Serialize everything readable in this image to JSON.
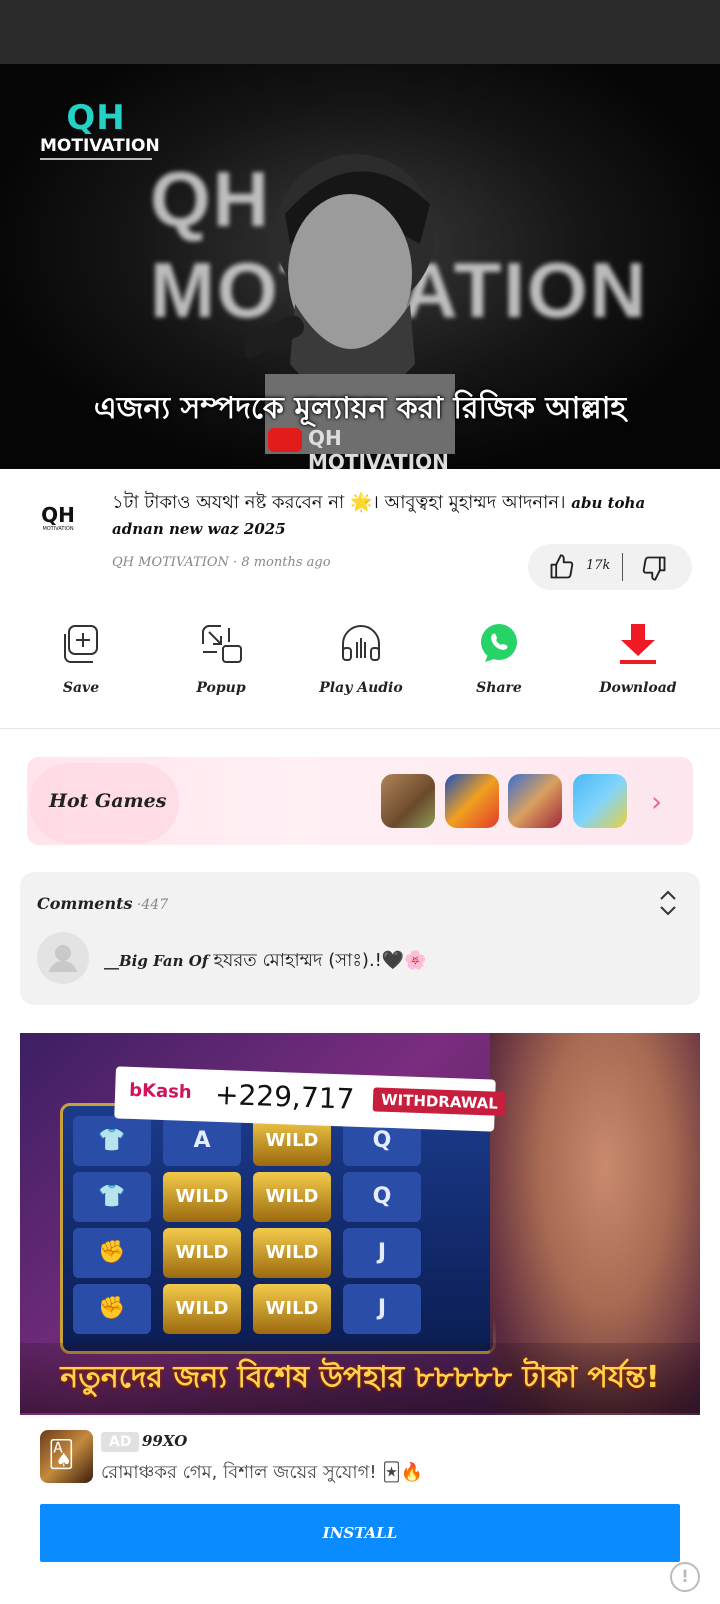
{
  "player": {
    "brand_top": "QH",
    "brand_bottom": "MOTIVATION",
    "background_title": "QH MOTIVATION",
    "watermark": "QH MOTIVATION",
    "caption": "এজন্য সম্পদকে মূল্যায়ন করা রিজিক আল্লাহ"
  },
  "video": {
    "avatar_top": "QH",
    "avatar_bottom": "MOTIVATION",
    "title_bn": "১টা টাকাও অযথা নষ্ট করবেন না 🌟। আবুত্বহা মুহাম্মদ আদনান। ",
    "title_en": "abu toha adnan new waz 2025",
    "meta": "QH MOTIVATION · 8 months ago",
    "likes": "17k"
  },
  "actions": [
    {
      "label": "Save",
      "icon": "bookmark-add-icon"
    },
    {
      "label": "Popup",
      "icon": "popup-window-icon"
    },
    {
      "label": "Play Audio",
      "icon": "headphones-icon"
    },
    {
      "label": "Share",
      "icon": "whatsapp-icon"
    },
    {
      "label": "Download",
      "icon": "download-icon"
    }
  ],
  "hot_games": {
    "title": "Hot Games",
    "chevron": "›"
  },
  "comments": {
    "title": "Comments",
    "count": " ·447",
    "first_user": "__Big Fan Of ",
    "first_text": "হযরত মোহাম্মদ (সাঃ).!🖤🌸"
  },
  "ad": {
    "bkash_label": "bKash",
    "amount": "+229,717",
    "withdrawal": "WITHDRAWAL",
    "banner_text": "নতুনদের জন্য বিশেষ উপহার ৮৮৮৮৮ টাকা পর্যন্ত!",
    "wild": "WILD",
    "badge": "AD",
    "advertiser": "99XO",
    "description": "রোমাঞ্চকর গেম, বিশাল জয়ের সুযোগ! 🃏🔥",
    "install_label": "INSTALL",
    "info": "!"
  },
  "colors": {
    "accent_blue": "#0a8bff",
    "download_red": "#ee1b24",
    "whatsapp_green": "#25d366"
  }
}
